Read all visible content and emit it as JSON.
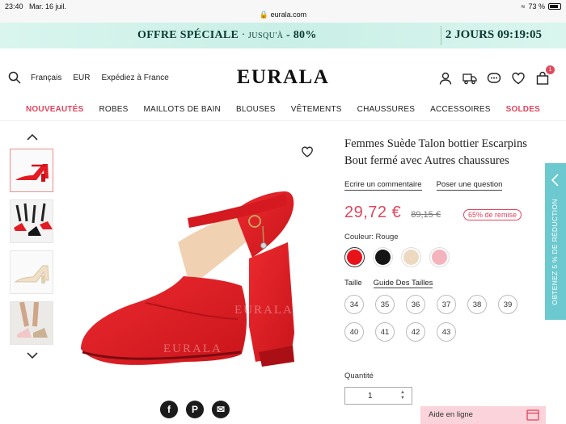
{
  "status": {
    "time": "23:40",
    "date": "Mar. 16 juil.",
    "url": "eurala.com",
    "battery": "73 %"
  },
  "promo": {
    "offer_title": "OFFRE SPÉCIALE",
    "sep": " · ",
    "upto": "JUSQU'À",
    "percent": "- 80%",
    "days": "2 JOURS",
    "clock": "09:19:05"
  },
  "header": {
    "language": "Français",
    "currency": "EUR",
    "ship": "Expédiez à France",
    "logo": "EURALA",
    "cart_count": "1"
  },
  "nav": {
    "items": [
      "NOUVEAUTÉS",
      "ROBES",
      "MAILLOTS DE BAIN",
      "BLOUSES",
      "VÊTEMENTS",
      "CHAUSSURES",
      "ACCESSOIRES",
      "SOLDES"
    ]
  },
  "product": {
    "title": "Femmes Suède Talon bottier Escarpins Bout fermé avec Autres chaussures",
    "review_link": "Ecrire un commentaire",
    "question_link": "Poser une question",
    "price": "29,72 €",
    "old_price": "89,15 €",
    "discount": "65% de remise",
    "color_label": "Couleur: Rouge",
    "colors": [
      "#e8121b",
      "#151515",
      "#ecd9c0",
      "#f4b4bd"
    ],
    "size_label": "Taille",
    "size_guide": "Guide Des Tailles",
    "sizes": [
      "34",
      "35",
      "36",
      "37",
      "38",
      "39",
      "40",
      "41",
      "42",
      "43"
    ],
    "qty_label": "Quantité",
    "qty": "1"
  },
  "watermark": "EURALA",
  "sidetab": "OBTENEZ 5 % DE RÉDUCTION",
  "chat": "Aide en ligne"
}
